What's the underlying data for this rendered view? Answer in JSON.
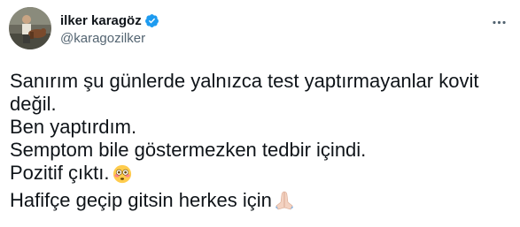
{
  "author": {
    "display_name": "ilker karagöz",
    "handle": "@karagozilker",
    "verified": true,
    "avatar_icon": "profile-photo",
    "verified_icon": "verified-badge-icon"
  },
  "menu": {
    "icon": "more-horizontal-icon"
  },
  "tweet": {
    "lines": [
      "Sanırım şu günlerde yalnızca test yaptırmayanlar kovit",
      "değil.",
      "Ben yaptırdım.",
      "Semptom bile göstermezken tedbir içindi.",
      "Pozitif çıktı.",
      "Hafifçe geçip gitsin herkes için"
    ],
    "emojis": {
      "line5": "flushed-face-emoji",
      "line6": "folded-hands-emoji"
    }
  },
  "colors": {
    "text_primary": "#0f1419",
    "text_secondary": "#536471",
    "verified_blue": "#1d9bf0"
  }
}
